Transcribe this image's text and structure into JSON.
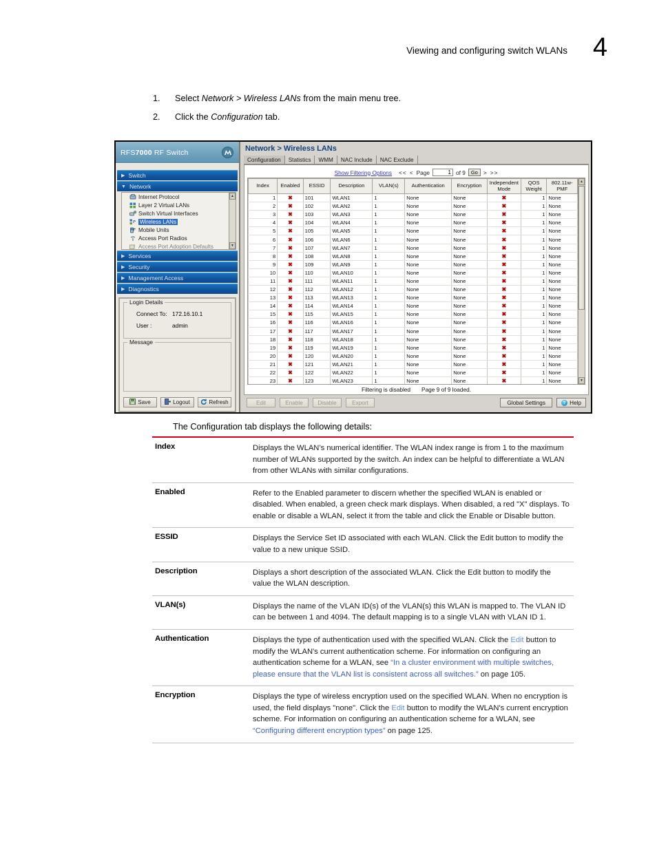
{
  "page": {
    "header_title": "Viewing and configuring switch WLANs",
    "chapter_number": "4"
  },
  "steps": [
    {
      "num": "1.",
      "pre": "Select ",
      "em1": "Network > Wireless LANs",
      "post": " from the main menu tree."
    },
    {
      "num": "2.",
      "pre": "Click the ",
      "em1": "Configuration",
      "post": " tab."
    }
  ],
  "screenshot": {
    "brand": {
      "prefix": "RFS",
      "bold": "7000",
      "suffix": " RF Switch",
      "logo_icon": "motorola-logo-icon"
    },
    "nav_sections": [
      {
        "label": "Switch",
        "expanded": false
      },
      {
        "label": "Network",
        "expanded": true
      },
      {
        "label": "Services",
        "expanded": false
      },
      {
        "label": "Security",
        "expanded": false
      },
      {
        "label": "Management Access",
        "expanded": false
      },
      {
        "label": "Diagnostics",
        "expanded": false
      }
    ],
    "tree_items": [
      {
        "label": "Internet Protocol",
        "selected": false,
        "icon": "protocol-icon"
      },
      {
        "label": "Layer 2 Virtual LANs",
        "selected": false,
        "icon": "vlan-icon"
      },
      {
        "label": "Switch Virtual Interfaces",
        "selected": false,
        "icon": "interface-icon"
      },
      {
        "label": "Wireless LANs",
        "selected": true,
        "icon": "wlan-icon"
      },
      {
        "label": "Mobile Units",
        "selected": false,
        "icon": "mobile-unit-icon"
      },
      {
        "label": "Access Port Radios",
        "selected": false,
        "icon": "radio-icon"
      },
      {
        "label": "Access Port Adoption Defaults",
        "selected": false,
        "icon": "adoption-icon"
      }
    ],
    "login": {
      "legend": "Login Details",
      "connect_label": "Connect To:",
      "connect_value": "172.16.10.1",
      "user_label": "User :",
      "user_value": "admin",
      "message_legend": "Message",
      "message_value": "",
      "buttons": [
        {
          "label": "Save",
          "icon": "save-icon"
        },
        {
          "label": "Logout",
          "icon": "logout-icon"
        },
        {
          "label": "Refresh",
          "icon": "refresh-icon"
        }
      ]
    },
    "breadcrumb": "Network > Wireless LANs",
    "tabs": [
      {
        "label": "Configuration",
        "active": true
      },
      {
        "label": "Statistics",
        "active": false
      },
      {
        "label": "WMM",
        "active": false
      },
      {
        "label": "NAC Include",
        "active": false
      },
      {
        "label": "NAC Exclude",
        "active": false
      }
    ],
    "toolbar": {
      "filter_link": "Show Filtering Options",
      "first_label": "<<",
      "prev_label": "<",
      "page_label": "Page",
      "page_value": "1",
      "of_label": "of 9",
      "go_label": "Go",
      "next_label": ">",
      "last_label": ">>"
    },
    "grid": {
      "columns": [
        "Index",
        "Enabled",
        "ESSID",
        "Description",
        "VLAN(s)",
        "Authentication",
        "Encryption",
        "Independent Mode",
        "QOS Weight",
        "802.11w-PMF"
      ],
      "rows": [
        {
          "index": "1",
          "enabled": "x",
          "essid": "101",
          "description": "WLAN1",
          "vlans": "1",
          "authentication": "None",
          "encryption": "None",
          "independent_mode": "x",
          "qos_weight": "1",
          "pmf": "None"
        },
        {
          "index": "2",
          "enabled": "x",
          "essid": "102",
          "description": "WLAN2",
          "vlans": "1",
          "authentication": "None",
          "encryption": "None",
          "independent_mode": "x",
          "qos_weight": "1",
          "pmf": "None"
        },
        {
          "index": "3",
          "enabled": "x",
          "essid": "103",
          "description": "WLAN3",
          "vlans": "1",
          "authentication": "None",
          "encryption": "None",
          "independent_mode": "x",
          "qos_weight": "1",
          "pmf": "None"
        },
        {
          "index": "4",
          "enabled": "x",
          "essid": "104",
          "description": "WLAN4",
          "vlans": "1",
          "authentication": "None",
          "encryption": "None",
          "independent_mode": "x",
          "qos_weight": "1",
          "pmf": "None"
        },
        {
          "index": "5",
          "enabled": "x",
          "essid": "105",
          "description": "WLAN5",
          "vlans": "1",
          "authentication": "None",
          "encryption": "None",
          "independent_mode": "x",
          "qos_weight": "1",
          "pmf": "None"
        },
        {
          "index": "6",
          "enabled": "x",
          "essid": "106",
          "description": "WLAN6",
          "vlans": "1",
          "authentication": "None",
          "encryption": "None",
          "independent_mode": "x",
          "qos_weight": "1",
          "pmf": "None"
        },
        {
          "index": "7",
          "enabled": "x",
          "essid": "107",
          "description": "WLAN7",
          "vlans": "1",
          "authentication": "None",
          "encryption": "None",
          "independent_mode": "x",
          "qos_weight": "1",
          "pmf": "None"
        },
        {
          "index": "8",
          "enabled": "x",
          "essid": "108",
          "description": "WLAN8",
          "vlans": "1",
          "authentication": "None",
          "encryption": "None",
          "independent_mode": "x",
          "qos_weight": "1",
          "pmf": "None"
        },
        {
          "index": "9",
          "enabled": "x",
          "essid": "109",
          "description": "WLAN9",
          "vlans": "1",
          "authentication": "None",
          "encryption": "None",
          "independent_mode": "x",
          "qos_weight": "1",
          "pmf": "None"
        },
        {
          "index": "10",
          "enabled": "x",
          "essid": "110",
          "description": "WLAN10",
          "vlans": "1",
          "authentication": "None",
          "encryption": "None",
          "independent_mode": "x",
          "qos_weight": "1",
          "pmf": "None"
        },
        {
          "index": "11",
          "enabled": "x",
          "essid": "111",
          "description": "WLAN11",
          "vlans": "1",
          "authentication": "None",
          "encryption": "None",
          "independent_mode": "x",
          "qos_weight": "1",
          "pmf": "None"
        },
        {
          "index": "12",
          "enabled": "x",
          "essid": "112",
          "description": "WLAN12",
          "vlans": "1",
          "authentication": "None",
          "encryption": "None",
          "independent_mode": "x",
          "qos_weight": "1",
          "pmf": "None"
        },
        {
          "index": "13",
          "enabled": "x",
          "essid": "113",
          "description": "WLAN13",
          "vlans": "1",
          "authentication": "None",
          "encryption": "None",
          "independent_mode": "x",
          "qos_weight": "1",
          "pmf": "None"
        },
        {
          "index": "14",
          "enabled": "x",
          "essid": "114",
          "description": "WLAN14",
          "vlans": "1",
          "authentication": "None",
          "encryption": "None",
          "independent_mode": "x",
          "qos_weight": "1",
          "pmf": "None"
        },
        {
          "index": "15",
          "enabled": "x",
          "essid": "115",
          "description": "WLAN15",
          "vlans": "1",
          "authentication": "None",
          "encryption": "None",
          "independent_mode": "x",
          "qos_weight": "1",
          "pmf": "None"
        },
        {
          "index": "16",
          "enabled": "x",
          "essid": "116",
          "description": "WLAN16",
          "vlans": "1",
          "authentication": "None",
          "encryption": "None",
          "independent_mode": "x",
          "qos_weight": "1",
          "pmf": "None"
        },
        {
          "index": "17",
          "enabled": "x",
          "essid": "117",
          "description": "WLAN17",
          "vlans": "1",
          "authentication": "None",
          "encryption": "None",
          "independent_mode": "x",
          "qos_weight": "1",
          "pmf": "None"
        },
        {
          "index": "18",
          "enabled": "x",
          "essid": "118",
          "description": "WLAN18",
          "vlans": "1",
          "authentication": "None",
          "encryption": "None",
          "independent_mode": "x",
          "qos_weight": "1",
          "pmf": "None"
        },
        {
          "index": "19",
          "enabled": "x",
          "essid": "119",
          "description": "WLAN19",
          "vlans": "1",
          "authentication": "None",
          "encryption": "None",
          "independent_mode": "x",
          "qos_weight": "1",
          "pmf": "None"
        },
        {
          "index": "20",
          "enabled": "x",
          "essid": "120",
          "description": "WLAN20",
          "vlans": "1",
          "authentication": "None",
          "encryption": "None",
          "independent_mode": "x",
          "qos_weight": "1",
          "pmf": "None"
        },
        {
          "index": "21",
          "enabled": "x",
          "essid": "121",
          "description": "WLAN21",
          "vlans": "1",
          "authentication": "None",
          "encryption": "None",
          "independent_mode": "x",
          "qos_weight": "1",
          "pmf": "None"
        },
        {
          "index": "22",
          "enabled": "x",
          "essid": "122",
          "description": "WLAN22",
          "vlans": "1",
          "authentication": "None",
          "encryption": "None",
          "independent_mode": "x",
          "qos_weight": "1",
          "pmf": "None"
        },
        {
          "index": "23",
          "enabled": "x",
          "essid": "123",
          "description": "WLAN23",
          "vlans": "1",
          "authentication": "None",
          "encryption": "None",
          "independent_mode": "x",
          "qos_weight": "1",
          "pmf": "None"
        }
      ]
    },
    "status": {
      "filtering": "Filtering is disabled",
      "loaded": "Page 9 of 9 loaded."
    },
    "actions": {
      "edit": "Edit",
      "enable": "Enable",
      "disable": "Disable",
      "export": "Export",
      "global_settings": "Global Settings",
      "help": "Help"
    }
  },
  "caption": "The Configuration tab displays the following details:",
  "definitions": [
    {
      "term": "Index",
      "parts": [
        {
          "t": "Displays the WLAN’s numerical identifier. The WLAN index range is from 1 to the maximum number of WLANs supported by the switch. An index can be helpful to differentiate a WLAN from other WLANs with similar configurations."
        }
      ]
    },
    {
      "term": "Enabled",
      "parts": [
        {
          "t": "Refer to the Enabled parameter to discern whether the specified WLAN is enabled or disabled. When enabled, a green check mark displays. When disabled, a red \"X\" displays. To enable or disable a WLAN, select it from the table and click the Enable or Disable button."
        }
      ]
    },
    {
      "term": "ESSID",
      "parts": [
        {
          "t": "Displays the Service Set ID associated with each WLAN. Click the Edit button to modify the value to a new unique SSID."
        }
      ]
    },
    {
      "term": "Description",
      "parts": [
        {
          "t": "Displays a short description of the associated WLAN. Click the Edit button to modify the value the WLAN description."
        }
      ]
    },
    {
      "term": "VLAN(s)",
      "parts": [
        {
          "t": "Displays the name of the VLAN ID(s) of the VLAN(s) this WLAN is mapped to. The VLAN ID can be between 1 and 4094. The default mapping is to a single VLAN with VLAN ID 1."
        }
      ]
    },
    {
      "term": "Authentication",
      "parts": [
        {
          "t": "Displays the type of authentication used with the specified WLAN. Click the "
        },
        {
          "t": "Edit",
          "style": "lnk-lt"
        },
        {
          "t": " button to modify the WLAN's current authentication scheme. For information on configuring an authentication scheme for a WLAN, see "
        },
        {
          "t": "“In a cluster environment with multiple switches, please ensure that the VLAN list is consistent across all switches.”",
          "style": "lnk-blue"
        },
        {
          "t": " on page 105."
        }
      ]
    },
    {
      "term": "Encryption",
      "parts": [
        {
          "t": "Displays the type of wireless encryption used on the specified WLAN. When no encryption is used, the field displays \"none\". Click the "
        },
        {
          "t": "Edit",
          "style": "lnk-lt"
        },
        {
          "t": " button to modify the WLAN's current encryption scheme. For information on configuring an authentication scheme for a WLAN, see "
        },
        {
          "t": "“Configuring different encryption types”",
          "style": "lnk-blue"
        },
        {
          "t": " on page 125."
        }
      ]
    }
  ]
}
